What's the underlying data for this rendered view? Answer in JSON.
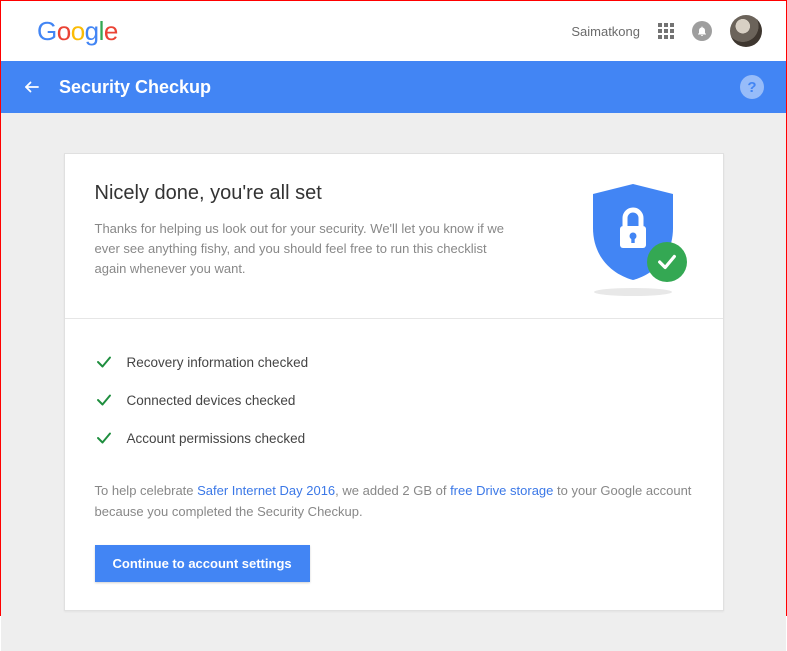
{
  "header": {
    "logo_letters": [
      "G",
      "o",
      "o",
      "g",
      "l",
      "e"
    ],
    "username": "Saimatkong"
  },
  "bluebar": {
    "title": "Security Checkup",
    "help_glyph": "?"
  },
  "card": {
    "title": "Nicely done, you're all set",
    "subtitle": "Thanks for helping us look out for your security. We'll let you know if we ever see anything fishy, and you should feel free to run this checklist again whenever you want.",
    "checks": [
      "Recovery information checked",
      "Connected devices checked",
      "Account permissions checked"
    ],
    "promo": {
      "part1": "To help celebrate ",
      "link1": "Safer Internet Day 2016",
      "part2": ", we added 2 GB of ",
      "link2": "free Drive storage",
      "part3": " to your Google account because you completed the Security Checkup."
    },
    "cta_label": "Continue to account settings"
  }
}
